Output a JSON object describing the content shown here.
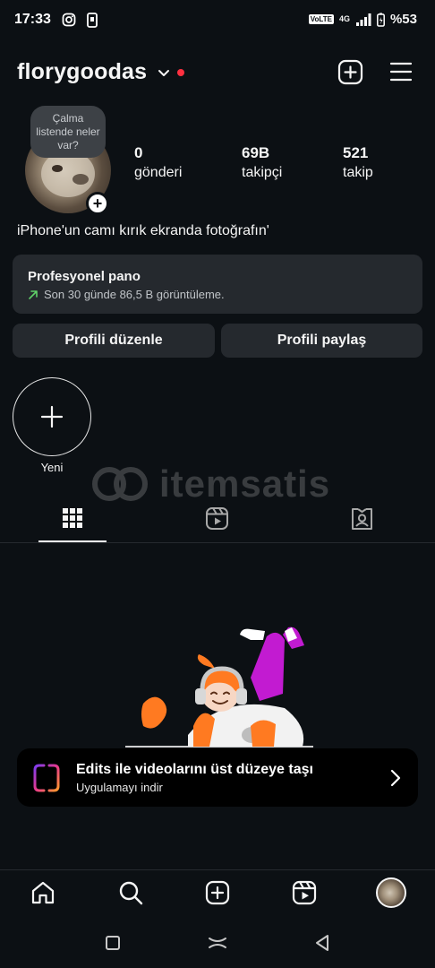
{
  "status_bar": {
    "time": "17:33",
    "volte": "VoLTE",
    "network": "4G",
    "battery": "%53"
  },
  "header": {
    "username": "florygoodas",
    "notification_dot_color": "#ff3040"
  },
  "profile": {
    "note": "Çalma listende neler var?",
    "stats": [
      {
        "value": "0",
        "label": "gönderi"
      },
      {
        "value": "69B",
        "label": "takipçi"
      },
      {
        "value": "521",
        "label": "takip"
      }
    ],
    "bio": "iPhone'un camı kırık ekranda fotoğrafın'"
  },
  "dashboard": {
    "title": "Profesyonel pano",
    "subtitle": "Son 30 günde 86,5 B görüntüleme."
  },
  "buttons": {
    "edit_profile": "Profili düzenle",
    "share_profile": "Profili paylaş"
  },
  "highlights": {
    "new_label": "Yeni"
  },
  "watermark": {
    "text": "itemsatis"
  },
  "banner": {
    "title": "Edits ile videolarını üst düzeye taşı",
    "subtitle": "Uygulamayı indir"
  },
  "colors": {
    "background": "#0c1014",
    "surface": "#25292e",
    "accent_green": "#5fd068",
    "illustration_orange": "#ff7a21",
    "illustration_magenta": "#c21bd1"
  }
}
